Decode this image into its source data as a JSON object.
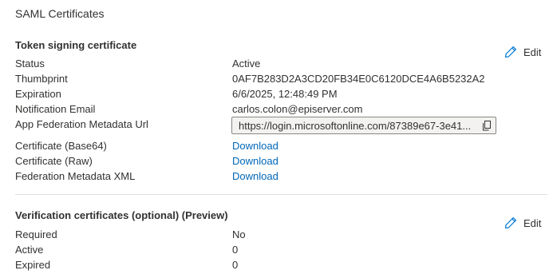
{
  "page": {
    "title": "SAML Certificates"
  },
  "token_signing": {
    "title": "Token signing certificate",
    "edit_label": "Edit",
    "rows": [
      {
        "label": "Status",
        "value": "Active"
      },
      {
        "label": "Thumbprint",
        "value": "0AF7B283D2A3CD20FB34E0C6120DCE4A6B5232A2"
      },
      {
        "label": "Expiration",
        "value": "6/6/2025, 12:48:49 PM"
      },
      {
        "label": "Notification Email",
        "value": "carlos.colon@episerver.com"
      },
      {
        "label": "App Federation Metadata Url",
        "value": "https://login.microsoftonline.com/87389e67-3e41..."
      },
      {
        "label": "Certificate (Base64)",
        "value": "Download"
      },
      {
        "label": "Certificate (Raw)",
        "value": "Download"
      },
      {
        "label": "Federation Metadata XML",
        "value": "Download"
      }
    ]
  },
  "verification": {
    "title": "Verification certificates (optional) (Preview)",
    "edit_label": "Edit",
    "rows": [
      {
        "label": "Required",
        "value": "No"
      },
      {
        "label": "Active",
        "value": "0"
      },
      {
        "label": "Expired",
        "value": "0"
      }
    ]
  },
  "icons": {
    "edit": "pencil-icon",
    "copy": "copy-icon"
  },
  "colors": {
    "link": "#0067b8",
    "text": "#323130",
    "accent": "#0078d4"
  }
}
